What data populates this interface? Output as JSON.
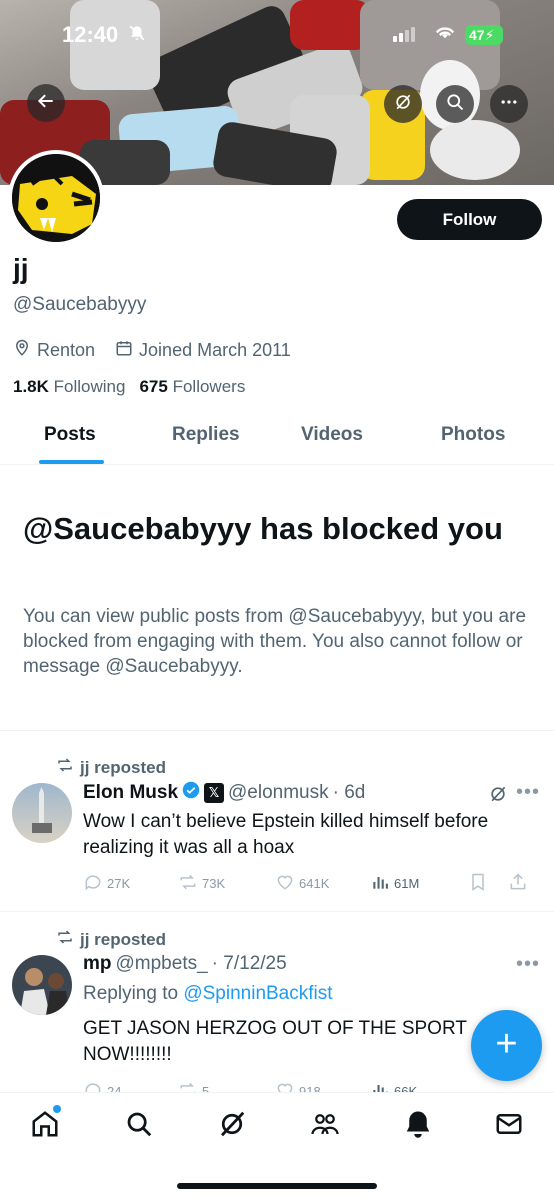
{
  "status_bar": {
    "time": "12:40",
    "battery": "47"
  },
  "profile": {
    "name": "jj",
    "handle": "@Saucebabyyy",
    "location": "Renton",
    "joined": "Joined March 2011",
    "following_count": "1.8K",
    "following_label": "Following",
    "followers_count": "675",
    "followers_label": "Followers",
    "follow_button": "Follow"
  },
  "tabs": [
    {
      "label": "Posts"
    },
    {
      "label": "Replies"
    },
    {
      "label": "Videos"
    },
    {
      "label": "Photos"
    }
  ],
  "blocked": {
    "title": "@Saucebabyyy has blocked you",
    "description": "You can view public posts from @Saucebabyyy, but you are blocked from engaging with them. You also cannot follow or message @Saucebabyyy."
  },
  "posts": [
    {
      "repost_label": "jj reposted",
      "name": "Elon Musk",
      "handle": "@elonmusk",
      "time": "· 6d",
      "text": "Wow I can’t believe Epstein killed himself before realizing it was all a hoax",
      "replies": "27K",
      "reposts": "73K",
      "likes": "641K",
      "views": "61M"
    },
    {
      "repost_label": "jj reposted",
      "name": "mp",
      "handle": "@mpbets_",
      "time": "· 7/12/25",
      "replying_prefix": "Replying to",
      "replying_to": "@SpinninBackfist",
      "text": "GET JASON HERZOG OUT OF THE SPORT NOW!!!!!!!!",
      "replies": "24",
      "reposts": "5",
      "likes": "918",
      "views": "66K"
    }
  ],
  "colors": {
    "accent": "#1d9bf0",
    "text": "#0f1419",
    "secondary": "#536471"
  },
  "icons": [
    "back-arrow-icon",
    "grok-icon",
    "search-icon",
    "more-icon",
    "location-icon",
    "calendar-icon",
    "repost-icon",
    "verified-icon",
    "x-logo-icon",
    "reply-icon",
    "like-icon",
    "views-icon",
    "bookmark-icon",
    "share-icon",
    "compose-icon",
    "home-icon",
    "communities-icon",
    "notifications-icon",
    "messages-icon"
  ]
}
